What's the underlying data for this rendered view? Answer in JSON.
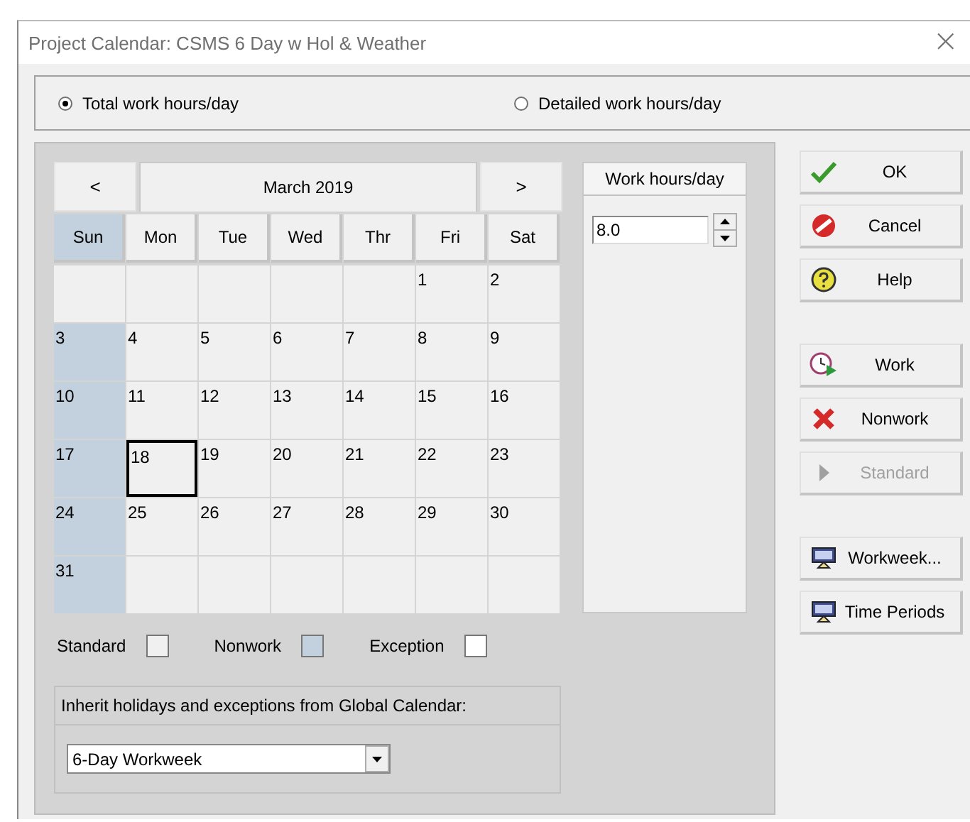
{
  "window": {
    "title": "Project Calendar: CSMS 6 Day w Hol & Weather",
    "close": "×"
  },
  "mode_options": [
    {
      "label": "Total work hours/day",
      "selected": true
    },
    {
      "label": "Detailed work hours/day",
      "selected": false
    }
  ],
  "calendar": {
    "prev": "<",
    "month": "March 2019",
    "next": ">",
    "day_headers": [
      {
        "label": "Sun",
        "nonwork": true
      },
      {
        "label": "Mon",
        "nonwork": false
      },
      {
        "label": "Tue",
        "nonwork": false
      },
      {
        "label": "Wed",
        "nonwork": false
      },
      {
        "label": "Thr",
        "nonwork": false
      },
      {
        "label": "Fri",
        "nonwork": false
      },
      {
        "label": "Sat",
        "nonwork": false
      }
    ],
    "weeks": [
      [
        {
          "kind": "blank",
          "selected": false
        },
        {
          "kind": "blank",
          "selected": false
        },
        {
          "kind": "blank",
          "selected": false
        },
        {
          "kind": "blank",
          "selected": false
        },
        {
          "kind": "blank",
          "selected": false
        },
        {
          "kind": "standard",
          "day": "1",
          "selected": false
        },
        {
          "kind": "standard",
          "day": "2",
          "selected": false
        }
      ],
      [
        {
          "kind": "nonwork",
          "day": "3",
          "selected": false
        },
        {
          "kind": "standard",
          "day": "4",
          "selected": false
        },
        {
          "kind": "standard",
          "day": "5",
          "selected": false
        },
        {
          "kind": "standard",
          "day": "6",
          "selected": false
        },
        {
          "kind": "standard",
          "day": "7",
          "selected": false
        },
        {
          "kind": "standard",
          "day": "8",
          "selected": false
        },
        {
          "kind": "standard",
          "day": "9",
          "selected": false
        }
      ],
      [
        {
          "kind": "nonwork",
          "day": "10",
          "selected": false
        },
        {
          "kind": "standard",
          "day": "11",
          "selected": false
        },
        {
          "kind": "standard",
          "day": "12",
          "selected": false
        },
        {
          "kind": "standard",
          "day": "13",
          "selected": false
        },
        {
          "kind": "standard",
          "day": "14",
          "selected": false
        },
        {
          "kind": "standard",
          "day": "15",
          "selected": false
        },
        {
          "kind": "standard",
          "day": "16",
          "selected": false
        }
      ],
      [
        {
          "kind": "nonwork",
          "day": "17",
          "selected": false
        },
        {
          "kind": "standard",
          "day": "18",
          "selected": true
        },
        {
          "kind": "standard",
          "day": "19",
          "selected": false
        },
        {
          "kind": "standard",
          "day": "20",
          "selected": false
        },
        {
          "kind": "standard",
          "day": "21",
          "selected": false
        },
        {
          "kind": "standard",
          "day": "22",
          "selected": false
        },
        {
          "kind": "standard",
          "day": "23",
          "selected": false
        }
      ],
      [
        {
          "kind": "nonwork",
          "day": "24",
          "selected": false
        },
        {
          "kind": "standard",
          "day": "25",
          "selected": false
        },
        {
          "kind": "standard",
          "day": "26",
          "selected": false
        },
        {
          "kind": "standard",
          "day": "27",
          "selected": false
        },
        {
          "kind": "standard",
          "day": "28",
          "selected": false
        },
        {
          "kind": "standard",
          "day": "29",
          "selected": false
        },
        {
          "kind": "standard",
          "day": "30",
          "selected": false
        }
      ],
      [
        {
          "kind": "nonwork",
          "day": "31",
          "selected": false
        },
        {
          "kind": "blank",
          "selected": false
        },
        {
          "kind": "blank",
          "selected": false
        },
        {
          "kind": "blank",
          "selected": false
        },
        {
          "kind": "blank",
          "selected": false
        },
        {
          "kind": "blank",
          "selected": false
        },
        {
          "kind": "blank",
          "selected": false
        }
      ]
    ]
  },
  "work_hours": {
    "heading": "Work hours/day",
    "value": "8.0"
  },
  "legend": [
    {
      "label": "Standard",
      "color": "#f0f0f0"
    },
    {
      "label": "Nonwork",
      "color": "#c3d1de"
    },
    {
      "label": "Exception",
      "color": "#ffffff"
    }
  ],
  "inherit": {
    "label": "Inherit holidays and exceptions from Global Calendar:",
    "value": "6-Day Workweek"
  },
  "button_groups": [
    [
      {
        "label": "OK",
        "kind": "ok",
        "disabled": false
      },
      {
        "label": "Cancel",
        "kind": "cancel",
        "disabled": false
      },
      {
        "label": "Help",
        "kind": "help",
        "disabled": false
      }
    ],
    [
      {
        "label": "Work",
        "kind": "work",
        "disabled": false
      },
      {
        "label": "Nonwork",
        "kind": "nonwork",
        "disabled": false
      },
      {
        "label": "Standard",
        "kind": "standard",
        "disabled": true
      }
    ],
    [
      {
        "label": "Workweek...",
        "kind": "workweek",
        "disabled": false
      },
      {
        "label": "Time Periods",
        "kind": "periods",
        "disabled": false
      }
    ]
  ]
}
